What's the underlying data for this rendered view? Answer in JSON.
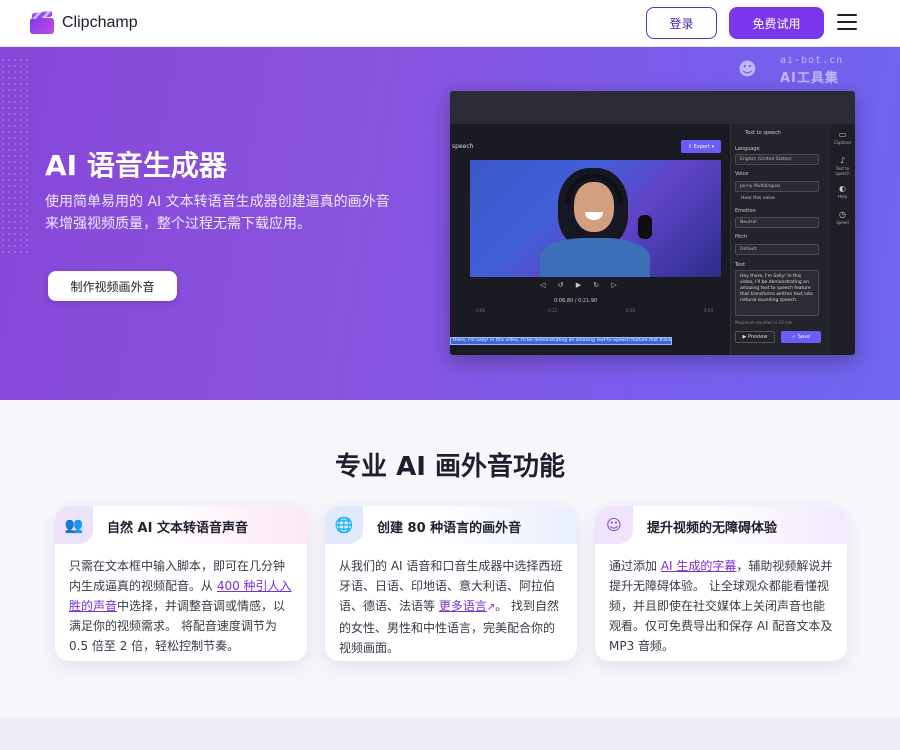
{
  "header": {
    "logo_text": "Clipchamp",
    "login_label": "登录",
    "trial_label": "免费试用"
  },
  "watermark": {
    "top": "ai-bot.cn",
    "bottom": "AI工具集"
  },
  "hero": {
    "title": "AI 语音生成器",
    "subtitle_line1": "使用简单易用的 AI 文本转语音生成器创建逼真的画外音",
    "subtitle_line2": "来增强视频质量，整个过程无需下载应用。",
    "cta_label": "制作视频画外音"
  },
  "editor": {
    "left_tab": "speech",
    "export_label": "Export",
    "panel_title": "Text to speech",
    "language_label": "Language",
    "language_value": "English (United States)",
    "voice_label": "Voice",
    "voice_value": "Jenny Multilingual",
    "hear_voice": "Hear this voice",
    "emotion_label": "Emotion",
    "emotion_value": "Neutral",
    "pitch_label": "Pitch",
    "pitch_value": "Default",
    "text_label": "Text",
    "text_value": "Hey there, I'm Sally! In this video, I'll be demonstrating an amazing text to speech feature that transforms written text into natural-sounding speech.",
    "max_note": "Maximum duration is 10 min",
    "preview_label": "Preview",
    "save_label": "Save",
    "time": "0:06.80 / 0:21.90",
    "ruler": [
      "0:06",
      "0:12",
      "0:16",
      "0:24"
    ],
    "track_text": "there, I'm Sally! In this video, I'll be demonstrating an amazing Text-to-Speech feature that transforms written",
    "right_items": [
      "Captions",
      "Text to speech",
      "Help",
      "Speed"
    ]
  },
  "features": {
    "title": "专业 AI 画外音功能",
    "cards": [
      {
        "icon": "people-icon",
        "title": "自然 AI 文本转语音声音",
        "body_before": "只需在文本框中输入脚本，即可在几分钟内生成逼真的视频配音。从 ",
        "link": "400 种引人入胜的声音",
        "body_after": "中选择，并调整音调或情感，以满足你的视频需求。 将配音速度调节为 0.5 倍至 2 倍，轻松控制节奏。"
      },
      {
        "icon": "globe-icon",
        "title": "创建 80 种语言的画外音",
        "body_before": "从我们的 AI 语音和口音生成器中选择西班牙语、日语、印地语、意大利语、阿拉伯语、德语、法语等 ",
        "link": "更多语言",
        "body_after": "。 找到自然的女性、男性和中性语言，完美配合你的视频画面。"
      },
      {
        "icon": "smile-icon",
        "title": "提升视频的无障碍体验",
        "body_before": "通过添加 ",
        "link": "AI 生成的字幕",
        "body_after": "，辅助视频解说并提升无障碍体验。 让全球观众都能看懂视频，并且即使在社交媒体上关闭声音也能观看。仅可免费导出和保存 AI 配音文本及 MP3 音频。"
      }
    ]
  },
  "colors": {
    "brand_purple": "#7b36ec",
    "link_purple": "#7a2fd6"
  }
}
